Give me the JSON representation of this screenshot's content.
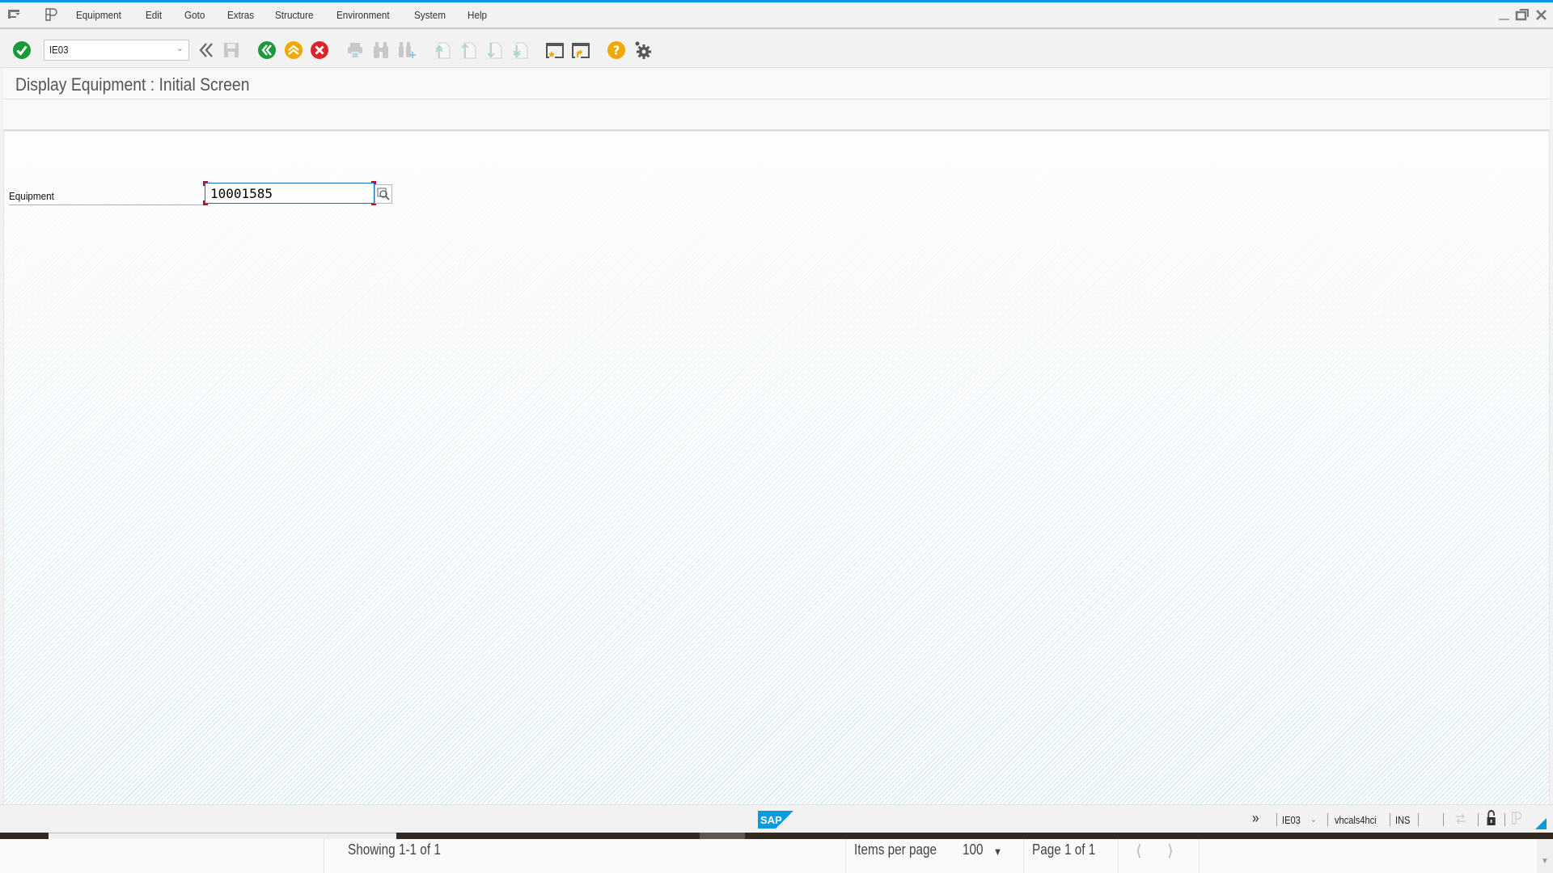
{
  "menubar": {
    "items": [
      "Equipment",
      "Edit",
      "Goto",
      "Extras",
      "Structure",
      "Environment",
      "System",
      "Help"
    ],
    "icons": [
      "sap-menu-icon",
      "layout-menu-icon"
    ],
    "window_controls": [
      "minimize",
      "restore",
      "close"
    ]
  },
  "toolbar": {
    "okcode_value": "IE03",
    "buttons": [
      "enter",
      "expand-okcode",
      "save",
      "back",
      "exit",
      "cancel",
      "print",
      "find",
      "find-next",
      "first-page",
      "previous-page",
      "next-page",
      "last-page",
      "create-session",
      "generate-shortcut",
      "help",
      "customize-layout"
    ]
  },
  "title": "Display Equipment : Initial Screen",
  "form": {
    "equipment_label": "Equipment",
    "equipment_value": "10001585"
  },
  "colors": {
    "accent": "#0a9ade",
    "enter_green": "#1a9a3a",
    "back_green": "#1a9a3a",
    "exit_orange": "#f0a800",
    "cancel_red": "#d9262c",
    "help_orange": "#f0a800"
  },
  "statusbar": {
    "transaction": "IE03",
    "system": "vhcals4hci",
    "mode": "INS"
  },
  "pager": {
    "showing": "Showing 1-1 of 1",
    "items_per_page_label": "Items per page",
    "items_per_page_value": "100",
    "page_info": "Page 1 of 1"
  }
}
